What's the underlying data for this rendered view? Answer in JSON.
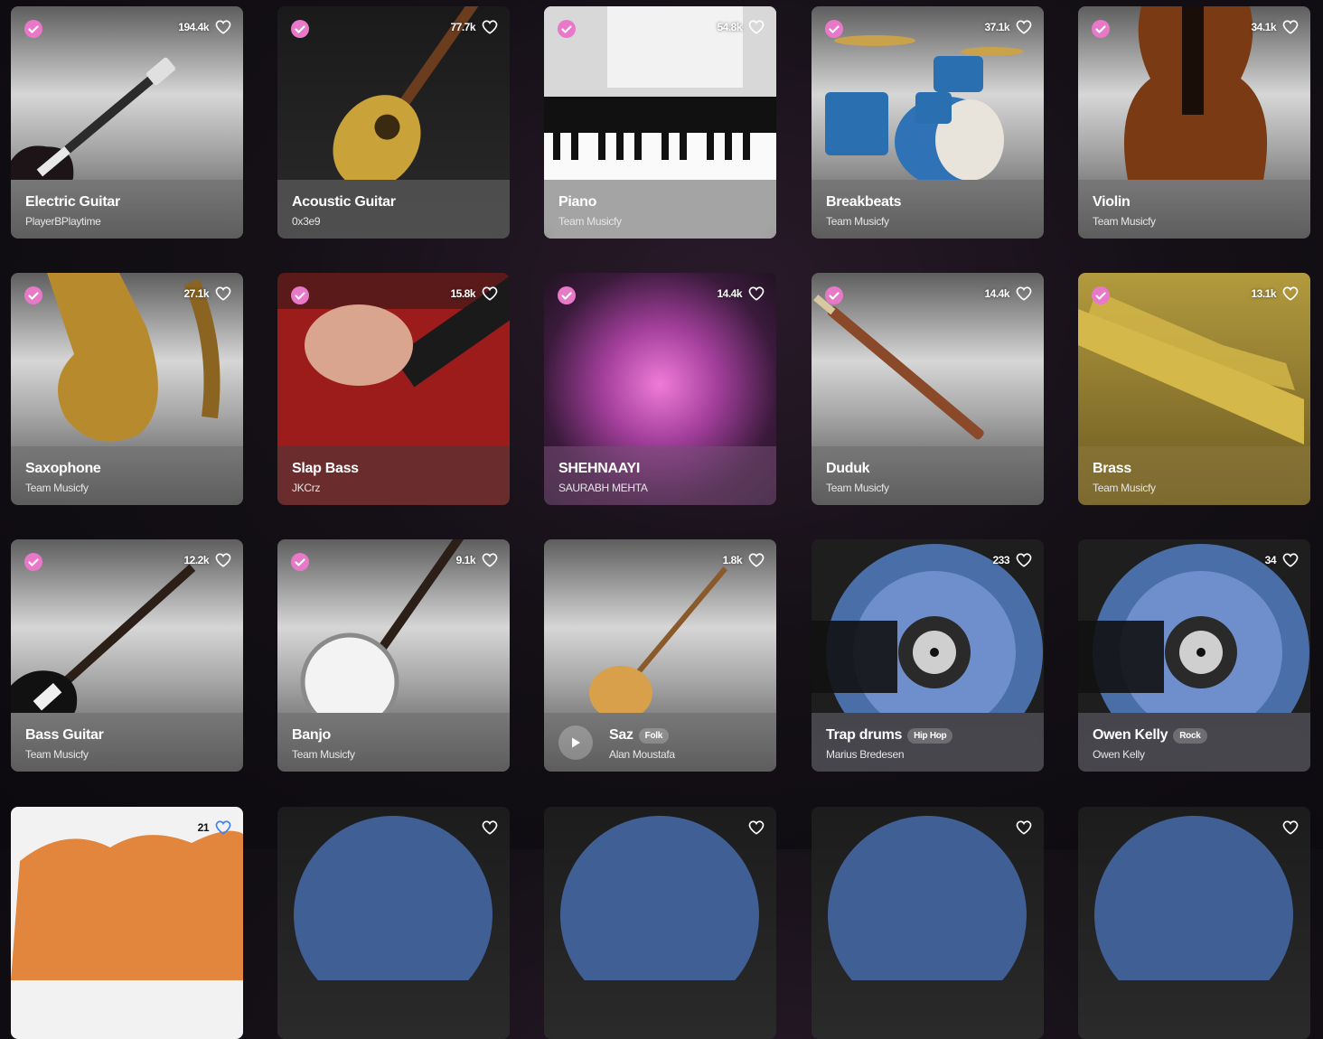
{
  "cards": [
    {
      "title": "Electric Guitar",
      "author": "PlayerBPlaytime",
      "likes": "194.4k",
      "verified": true,
      "tag": ""
    },
    {
      "title": "Acoustic Guitar",
      "author": "0x3e9",
      "likes": "77.7k",
      "verified": true,
      "tag": ""
    },
    {
      "title": "Piano",
      "author": "Team Musicfy",
      "likes": "54.8k",
      "verified": true,
      "tag": ""
    },
    {
      "title": "Breakbeats",
      "author": "Team Musicfy",
      "likes": "37.1k",
      "verified": true,
      "tag": ""
    },
    {
      "title": "Violin",
      "author": "Team Musicfy",
      "likes": "34.1k",
      "verified": true,
      "tag": ""
    },
    {
      "title": "Saxophone",
      "author": "Team Musicfy",
      "likes": "27.1k",
      "verified": true,
      "tag": ""
    },
    {
      "title": "Slap Bass",
      "author": "JKCrz",
      "likes": "15.8k",
      "verified": true,
      "tag": ""
    },
    {
      "title": "SHEHNAAYI",
      "author": "SAURABH MEHTA",
      "likes": "14.4k",
      "verified": true,
      "tag": ""
    },
    {
      "title": "Duduk",
      "author": "Team Musicfy",
      "likes": "14.4k",
      "verified": true,
      "tag": ""
    },
    {
      "title": "Brass",
      "author": "Team Musicfy",
      "likes": "13.1k",
      "verified": true,
      "tag": ""
    },
    {
      "title": "Bass Guitar",
      "author": "Team Musicfy",
      "likes": "12.2k",
      "verified": true,
      "tag": ""
    },
    {
      "title": "Banjo",
      "author": "Team Musicfy",
      "likes": "9.1k",
      "verified": true,
      "tag": ""
    },
    {
      "title": "Saz",
      "author": "Alan Moustafa",
      "likes": "1.8k",
      "verified": false,
      "tag": "Folk"
    },
    {
      "title": "Trap drums",
      "author": "Marius Bredesen",
      "likes": "233",
      "verified": false,
      "tag": "Hip Hop"
    },
    {
      "title": "Owen Kelly",
      "author": "Owen Kelly",
      "likes": "34",
      "verified": false,
      "tag": "Rock"
    }
  ],
  "bottom_row": [
    {
      "likes": "21"
    },
    {
      "likes": ""
    },
    {
      "likes": ""
    },
    {
      "likes": ""
    },
    {
      "likes": ""
    }
  ],
  "icons": {
    "verified": "verified-badge-icon",
    "heart": "heart-icon",
    "play": "play-icon"
  },
  "colors": {
    "verified": "#e879c9",
    "background": "#141016"
  }
}
